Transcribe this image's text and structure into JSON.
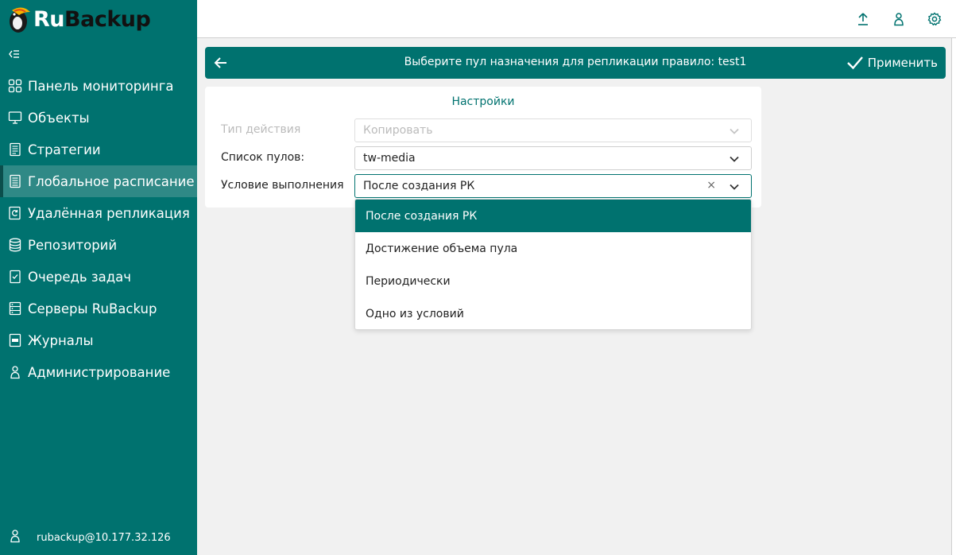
{
  "brand": {
    "part1": "Ru",
    "part2": "Backup"
  },
  "sidebar": {
    "items": [
      {
        "label": "Панель мониторинга",
        "icon": "dashboard-icon"
      },
      {
        "label": "Объекты",
        "icon": "monitor-icon"
      },
      {
        "label": "Стратегии",
        "icon": "document-icon"
      },
      {
        "label": "Глобальное расписание",
        "icon": "schedule-icon",
        "active": true
      },
      {
        "label": "Удалённая репликация",
        "icon": "replication-icon"
      },
      {
        "label": "Репозиторий",
        "icon": "database-icon"
      },
      {
        "label": "Очередь задач",
        "icon": "checklist-icon"
      },
      {
        "label": "Серверы RuBackup",
        "icon": "server-icon"
      },
      {
        "label": "Журналы",
        "icon": "log-icon"
      },
      {
        "label": "Администрирование",
        "icon": "admin-icon"
      }
    ],
    "user": "rubackup@10.177.32.126"
  },
  "header": {
    "title": "Выберите пул назначения для репликации правило: test1",
    "apply_label": "Применить"
  },
  "settings": {
    "title": "Настройки",
    "action_type": {
      "label": "Тип действия",
      "value": "Копировать",
      "disabled": true
    },
    "pool_list": {
      "label": "Список пулов:",
      "value": "tw-media"
    },
    "condition": {
      "label": "Условие выполнения",
      "value": "После создания РК"
    }
  },
  "dropdown": {
    "options": [
      {
        "label": "После создания РК",
        "selected": true
      },
      {
        "label": "Достижение объема пула"
      },
      {
        "label": "Периодически"
      },
      {
        "label": "Одно из условий"
      }
    ]
  },
  "colors": {
    "primary": "#00726f",
    "sidebar_active": "#2f8986",
    "background": "#f1f1f1"
  }
}
